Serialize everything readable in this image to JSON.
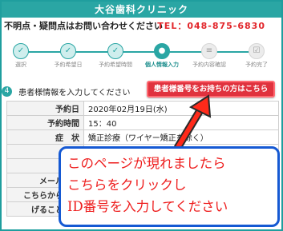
{
  "header": {
    "title": "大谷歯科クリニック",
    "inquiry": "不明点・疑問点はお問い合わせください",
    "tel": "TEL：048-875-6830"
  },
  "steps": [
    {
      "number": "1",
      "label": "選択",
      "state": "done",
      "icon": "check-icon"
    },
    {
      "number": "2",
      "label": "予約希望日",
      "state": "done",
      "icon": "check-icon"
    },
    {
      "number": "3",
      "label": "予約希望時間",
      "state": "done",
      "icon": "check-icon"
    },
    {
      "number": "4",
      "label": "個人情報入力",
      "state": "active",
      "icon": "person-icon"
    },
    {
      "number": "5",
      "label": "予約内容確認",
      "state": "pending",
      "icon": "document-icon"
    },
    {
      "number": "6",
      "label": "予約完了",
      "state": "pending",
      "icon": "checkbox-icon"
    }
  ],
  "section": {
    "number": "4",
    "title": "患者様情報を入力してください"
  },
  "id_button": {
    "label": "患者様番号をお持ちの方はこちら"
  },
  "form_rows": [
    {
      "label": "予約日",
      "value": "2020年02月19日(水)"
    },
    {
      "label": "予約時間",
      "value": "15：40"
    },
    {
      "label": "症　状",
      "value": "矯正診療（ワイヤー矯正を除く）"
    },
    {
      "label": "名",
      "value": ""
    },
    {
      "label": "電",
      "value": ""
    },
    {
      "label": "メールアド",
      "value": ""
    },
    {
      "label": "こちらからお電",
      "value": ""
    },
    {
      "label": "げることがご",
      "value": ""
    }
  ],
  "callout": {
    "line1": "このページが現れましたら",
    "line2": "こちらをクリックし",
    "line3": "ID番号を入力してください"
  },
  "colors": {
    "teal": "#2aa6a4",
    "tel_red": "#e2262b",
    "button_red": "#e0323e",
    "callout_border": "#1559d3",
    "callout_text": "#ee1c1c",
    "arrow": "#ff2a1a"
  }
}
